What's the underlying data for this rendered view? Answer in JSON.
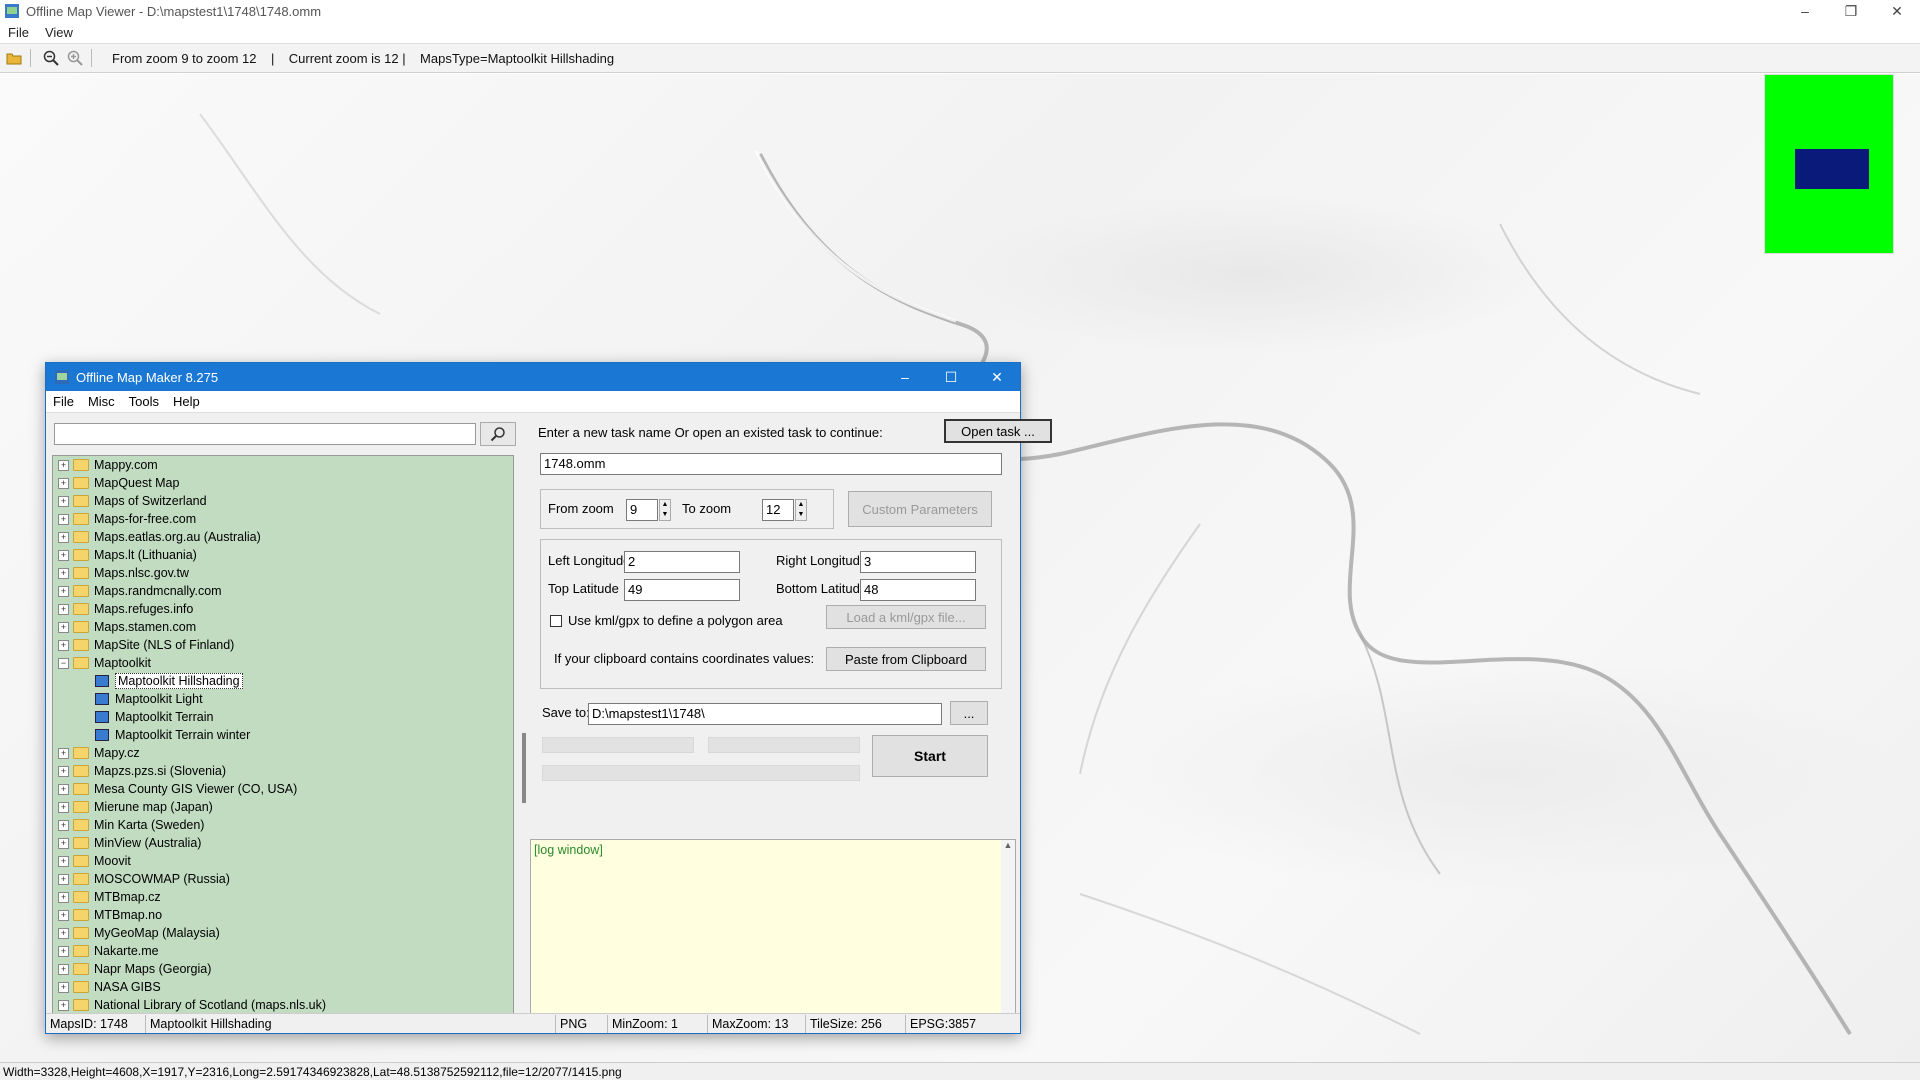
{
  "window": {
    "title": "Offline Map Viewer - D:\\mapstest1\\1748\\1748.omm",
    "controls": [
      "–",
      "❐",
      "✕"
    ]
  },
  "menu": {
    "items": [
      "File",
      "View"
    ]
  },
  "toolbar": {
    "info": "From zoom 9 to zoom 12    |    Current zoom is 12 |    MapsType=Maptoolkit Hillshading"
  },
  "status_bar": {
    "text": "Width=3328,Height=4608,X=1917,Y=2316,Long=2.59174346923828,Lat=48.5138752592112,file=12/2077/1415.png"
  },
  "minimap": {
    "bg_color": "#00ff00",
    "view_color": "#0a1a7a"
  },
  "dialog": {
    "title": "Offline Map Maker 8.275",
    "controls": [
      "–",
      "☐",
      "✕"
    ],
    "menu": [
      "File",
      "Misc",
      "Tools",
      "Help"
    ],
    "search": {
      "value": ""
    },
    "tree": [
      {
        "label": "Mappy.com",
        "type": "folder",
        "exp": "+"
      },
      {
        "label": "MapQuest Map",
        "type": "folder",
        "exp": "+"
      },
      {
        "label": "Maps of Switzerland",
        "type": "folder",
        "exp": "+"
      },
      {
        "label": "Maps-for-free.com",
        "type": "folder",
        "exp": "+"
      },
      {
        "label": "Maps.eatlas.org.au (Australia)",
        "type": "folder",
        "exp": "+"
      },
      {
        "label": "Maps.lt (Lithuania)",
        "type": "folder",
        "exp": "+"
      },
      {
        "label": "Maps.nlsc.gov.tw",
        "type": "folder",
        "exp": "+"
      },
      {
        "label": "Maps.randmcnally.com",
        "type": "folder",
        "exp": "+"
      },
      {
        "label": "Maps.refuges.info",
        "type": "folder",
        "exp": "+"
      },
      {
        "label": "Maps.stamen.com",
        "type": "folder",
        "exp": "+"
      },
      {
        "label": "MapSite (NLS of Finland)",
        "type": "folder",
        "exp": "+"
      },
      {
        "label": "Maptoolkit",
        "type": "folder",
        "exp": "−"
      },
      {
        "label": "Maptoolkit Hillshading",
        "type": "map",
        "selected": true
      },
      {
        "label": "Maptoolkit Light",
        "type": "map"
      },
      {
        "label": "Maptoolkit Terrain",
        "type": "map"
      },
      {
        "label": "Maptoolkit Terrain winter",
        "type": "map"
      },
      {
        "label": "Mapy.cz",
        "type": "folder",
        "exp": "+"
      },
      {
        "label": "Mapzs.pzs.si (Slovenia)",
        "type": "folder",
        "exp": "+"
      },
      {
        "label": "Mesa County GIS Viewer (CO, USA)",
        "type": "folder",
        "exp": "+"
      },
      {
        "label": "Mierune map (Japan)",
        "type": "folder",
        "exp": "+"
      },
      {
        "label": "Min Karta (Sweden)",
        "type": "folder",
        "exp": "+"
      },
      {
        "label": "MinView (Australia)",
        "type": "folder",
        "exp": "+"
      },
      {
        "label": "Moovit",
        "type": "folder",
        "exp": "+"
      },
      {
        "label": "MOSCOWMAP (Russia)",
        "type": "folder",
        "exp": "+"
      },
      {
        "label": "MTBmap.cz",
        "type": "folder",
        "exp": "+"
      },
      {
        "label": "MTBmap.no",
        "type": "folder",
        "exp": "+"
      },
      {
        "label": "MyGeoMap (Malaysia)",
        "type": "folder",
        "exp": "+"
      },
      {
        "label": "Nakarte.me",
        "type": "folder",
        "exp": "+"
      },
      {
        "label": "Napr Maps (Georgia)",
        "type": "folder",
        "exp": "+"
      },
      {
        "label": "NASA GIBS",
        "type": "folder",
        "exp": "+"
      },
      {
        "label": "National Library of Scotland (maps.nls.uk)",
        "type": "folder",
        "exp": "+"
      }
    ],
    "task": {
      "prompt": "Enter a new task name Or open an existed task to continue:",
      "open_button": "Open task ...",
      "name_value": "1748.omm"
    },
    "zoom": {
      "from_label": "From zoom",
      "from_value": "9",
      "to_label": "To zoom",
      "to_value": "12",
      "custom_button": "Custom Parameters"
    },
    "area": {
      "left_lon_label": "Left Longitude",
      "left_lon_value": "2",
      "right_lon_label": "Right Longitude",
      "right_lon_value": "3",
      "top_lat_label": "Top Latitude",
      "top_lat_value": "49",
      "bottom_lat_label": "Bottom Latitude",
      "bottom_lat_value": "48",
      "kml_label": "Use kml/gpx to define a polygon area",
      "kml_button": "Load a kml/gpx file...",
      "clipboard_label": "If your clipboard contains coordinates values:",
      "clipboard_button": "Paste from Clipboard"
    },
    "save": {
      "label": "Save to:",
      "value": "D:\\mapstest1\\1748\\",
      "browse_button": "..."
    },
    "start_button": "Start",
    "log": {
      "text": "[log window]"
    },
    "status": {
      "maps_id": "MapsID: 1748",
      "maps_name": "Maptoolkit Hillshading",
      "format": "PNG",
      "min_zoom": "MinZoom: 1",
      "max_zoom": "MaxZoom: 13",
      "tile_size": "TileSize: 256",
      "epsg": "EPSG:3857"
    }
  }
}
